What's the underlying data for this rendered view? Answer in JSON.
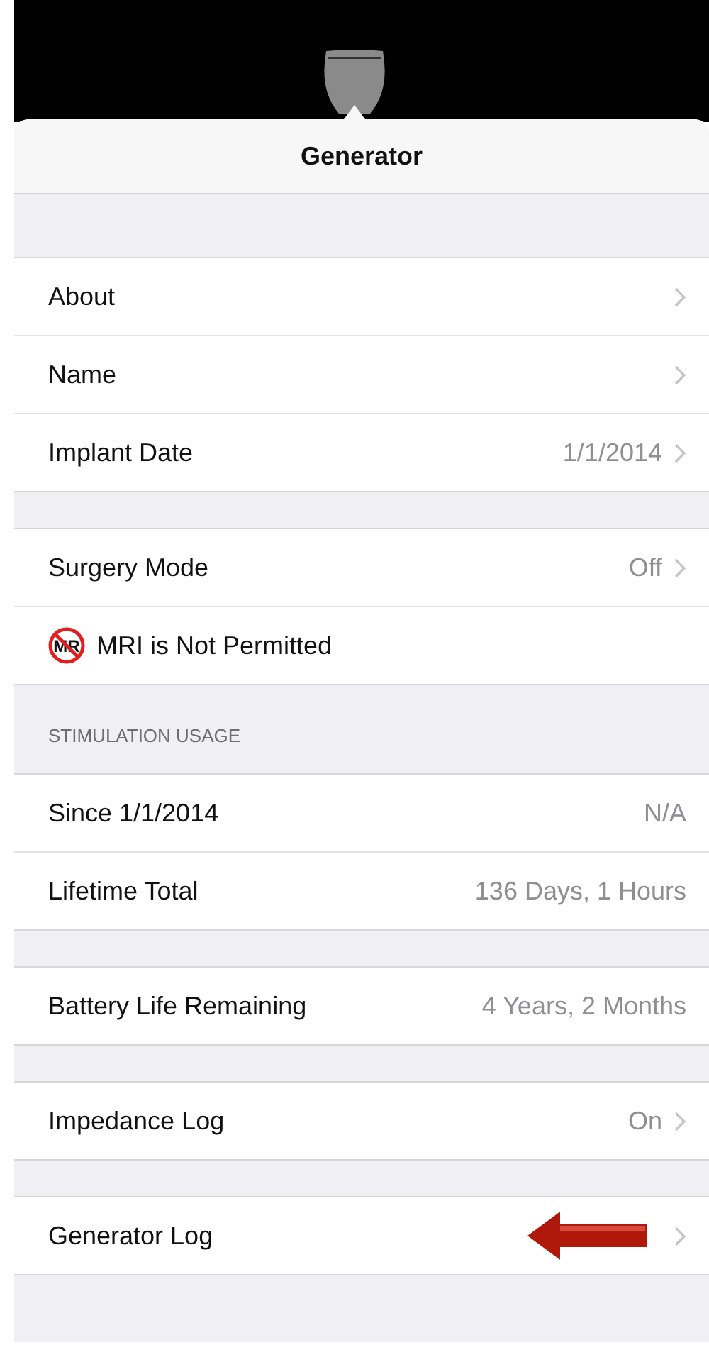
{
  "popover": {
    "title": "Generator"
  },
  "sections": [
    {
      "rows": [
        {
          "kind": "nav",
          "label": "About",
          "chevron": true
        },
        {
          "kind": "nav",
          "label": "Name",
          "chevron": true
        },
        {
          "kind": "nav",
          "label": "Implant Date",
          "value": "1/1/2014",
          "chevron": true
        }
      ]
    },
    {
      "rows": [
        {
          "kind": "nav",
          "label": "Surgery Mode",
          "value": "Off",
          "chevron": true
        },
        {
          "kind": "mri",
          "label": "MRI is Not Permitted",
          "icon_text": "MR"
        }
      ]
    },
    {
      "header": "STIMULATION USAGE",
      "rows": [
        {
          "kind": "nav",
          "label": "Since 1/1/2014",
          "value": "N/A"
        },
        {
          "kind": "nav",
          "label": "Lifetime Total",
          "value": "136 Days, 1 Hours"
        }
      ]
    },
    {
      "rows": [
        {
          "kind": "nav",
          "label": "Battery Life Remaining",
          "value": "4 Years, 2 Months"
        }
      ]
    },
    {
      "rows": [
        {
          "kind": "nav",
          "label": "Impedance Log",
          "value": "On",
          "chevron": true
        }
      ]
    },
    {
      "rows": [
        {
          "kind": "nav",
          "label": "Generator Log",
          "chevron": true,
          "arrow_annotation": true
        }
      ]
    }
  ]
}
